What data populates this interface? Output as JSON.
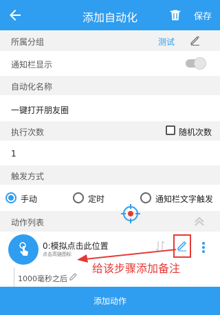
{
  "topbar": {
    "title": "添加自动化",
    "save_label": "保存"
  },
  "group": {
    "label": "所属分组",
    "value": "测试"
  },
  "notification": {
    "label": "通知栏显示"
  },
  "name": {
    "label": "自动化名称",
    "value": "一键打开朋友圈"
  },
  "exec": {
    "label": "执行次数",
    "random_label": "随机次数",
    "value": "1"
  },
  "trigger": {
    "label": "触发方式",
    "options": [
      "手动",
      "定时",
      "通知栏文字触发"
    ],
    "selected": "手动"
  },
  "actions": {
    "label": "动作列表",
    "items": [
      {
        "title": "0:模拟点击此位置",
        "subtitle": "点击高链图标"
      }
    ],
    "delay_text": "1000毫秒之后"
  },
  "annotation": {
    "text": "给该步骤添加备注"
  },
  "bottom": {
    "add_action_label": "添加动作"
  },
  "colors": {
    "primary": "#2f9df0",
    "annotation": "#e53935"
  }
}
